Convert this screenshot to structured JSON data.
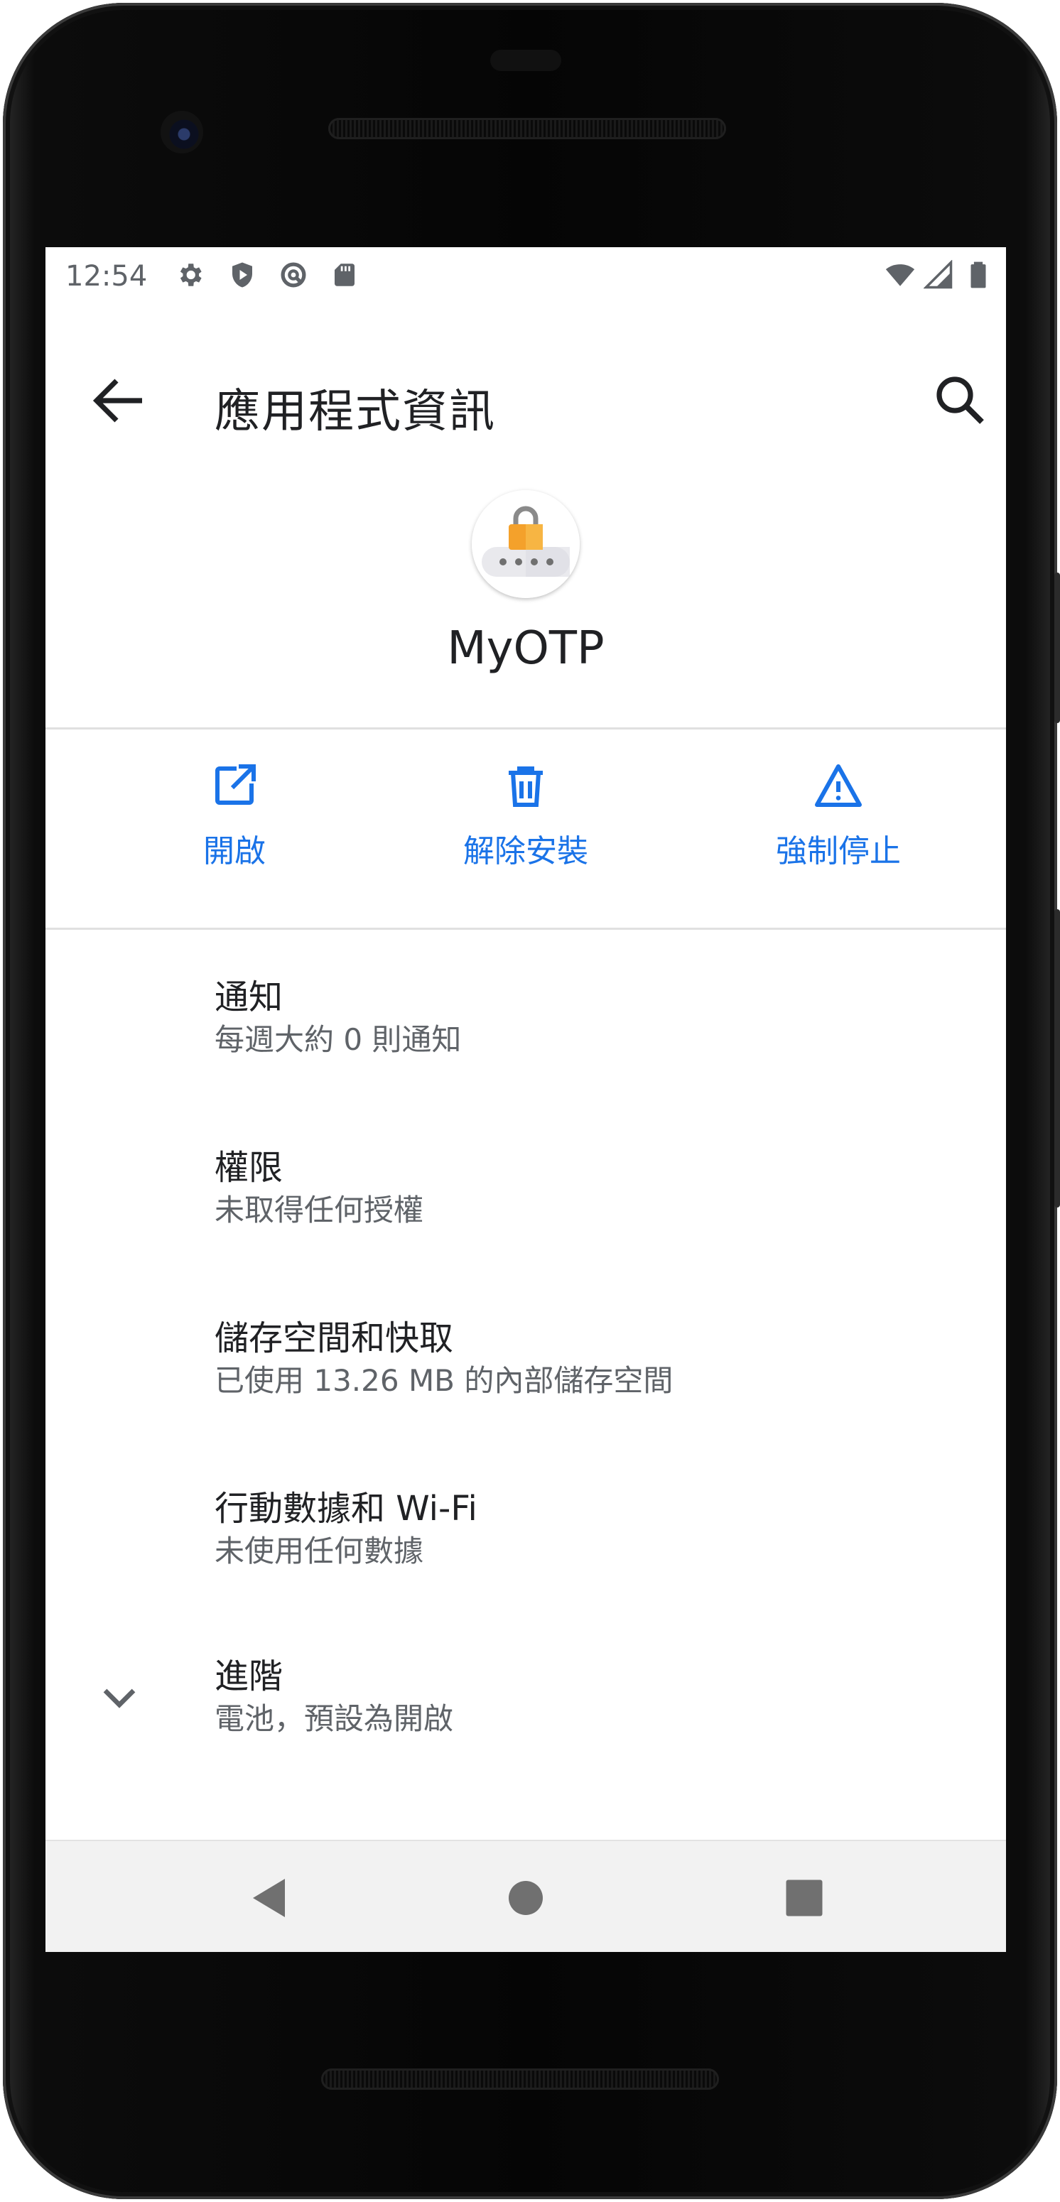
{
  "status_bar": {
    "time": "12:54",
    "left_icons": [
      "settings-icon",
      "shield-icon",
      "data-saver-icon",
      "sd-card-icon"
    ],
    "right_icons": [
      "wifi-icon",
      "cell-signal-icon",
      "battery-icon"
    ]
  },
  "toolbar": {
    "title": "應用程式資訊",
    "back_icon": "arrow-back-icon",
    "search_icon": "search-icon"
  },
  "app": {
    "name": "MyOTP",
    "icon": "lock-icon"
  },
  "actions": [
    {
      "label": "開啟",
      "icon": "open-external-icon"
    },
    {
      "label": "解除安裝",
      "icon": "trash-icon"
    },
    {
      "label": "強制停止",
      "icon": "warning-icon"
    }
  ],
  "settings": [
    {
      "title": "通知",
      "summary": "每週大約 0 則通知"
    },
    {
      "title": "權限",
      "summary": "未取得任何授權"
    },
    {
      "title": "儲存空間和快取",
      "summary": "已使用 13.26 MB 的內部儲存空間"
    },
    {
      "title": "行動數據和 Wi-Fi",
      "summary": "未使用任何數據"
    },
    {
      "title": "進階",
      "summary": "電池，預設為開啟",
      "icon": "chevron-down-icon"
    }
  ],
  "nav": {
    "back_icon": "nav-back-icon",
    "home_icon": "nav-home-icon",
    "recents_icon": "nav-recents-icon"
  },
  "colors": {
    "accent": "#1a73e8",
    "text_primary": "#202124",
    "text_secondary": "#5f6368",
    "lock_orange": "#f4a12b"
  }
}
